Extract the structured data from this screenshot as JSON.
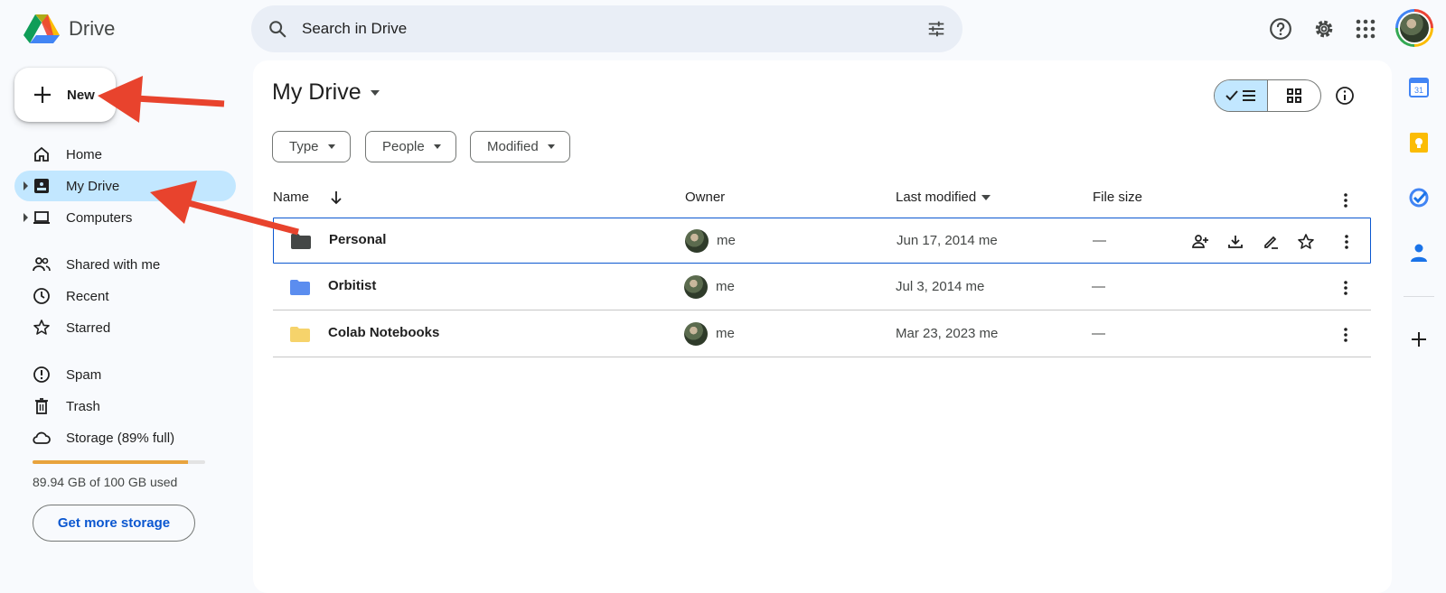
{
  "app": {
    "name": "Drive"
  },
  "search": {
    "placeholder": "Search in Drive"
  },
  "sidebar": {
    "new_label": "New",
    "items": [
      {
        "label": "Home"
      },
      {
        "label": "My Drive"
      },
      {
        "label": "Computers"
      },
      {
        "label": "Shared with me"
      },
      {
        "label": "Recent"
      },
      {
        "label": "Starred"
      },
      {
        "label": "Spam"
      },
      {
        "label": "Trash"
      },
      {
        "label": "Storage (89% full)"
      }
    ],
    "storage_used_pct": 89.94,
    "storage_text": "89.94 GB of 100 GB used",
    "get_storage_label": "Get more storage"
  },
  "main": {
    "title": "My Drive",
    "filters": [
      "Type",
      "People",
      "Modified"
    ],
    "columns": {
      "name": "Name",
      "owner": "Owner",
      "modified": "Last modified",
      "size": "File size"
    },
    "rows": [
      {
        "name": "Personal",
        "owner": "me",
        "modified": "Jun 17, 2014 me",
        "size": "—",
        "color": "#444746"
      },
      {
        "name": "Orbitist",
        "owner": "me",
        "modified": "Jul 3, 2014 me",
        "size": "—",
        "color": "#5b8def"
      },
      {
        "name": "Colab Notebooks",
        "owner": "me",
        "modified": "Mar 23, 2023 me",
        "size": "—",
        "color": "#f6d36b"
      }
    ]
  },
  "rail": {
    "calendar_day": "31"
  },
  "colors": {
    "accent": "#0b57d0",
    "selected_nav": "#c2e7ff",
    "arrow": "#e8432d"
  }
}
